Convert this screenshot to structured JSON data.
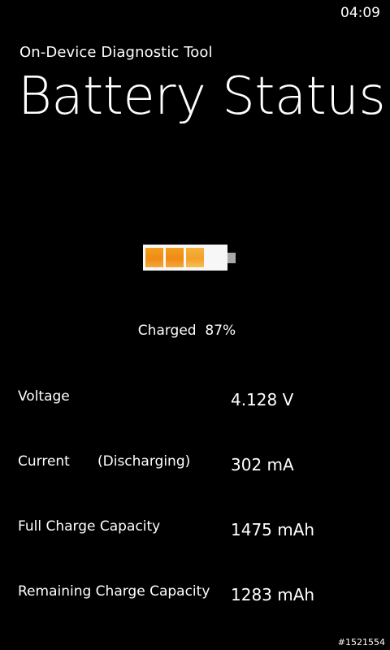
{
  "status_bar": {
    "time": "04:09"
  },
  "header": {
    "app_title": "On-Device Diagnostic Tool",
    "page_title": "Battery Status"
  },
  "battery": {
    "icon": "battery-icon",
    "charge_level_percent": 87,
    "status_text": "Charged  87%",
    "colors": {
      "fill": "#f08a14",
      "body": "#f7f7f7",
      "tip": "#a8a8a8"
    }
  },
  "metrics": [
    {
      "label": "Voltage",
      "note": "",
      "value": "4.128 V"
    },
    {
      "label": "Current",
      "note": "(Discharging)",
      "value": "302 mA"
    },
    {
      "label": "Full Charge Capacity",
      "note": "",
      "value": "1475 mAh"
    },
    {
      "label": "Remaining Charge Capacity",
      "note": "",
      "value": "1283 mAh"
    }
  ],
  "watermark": "#1521554"
}
